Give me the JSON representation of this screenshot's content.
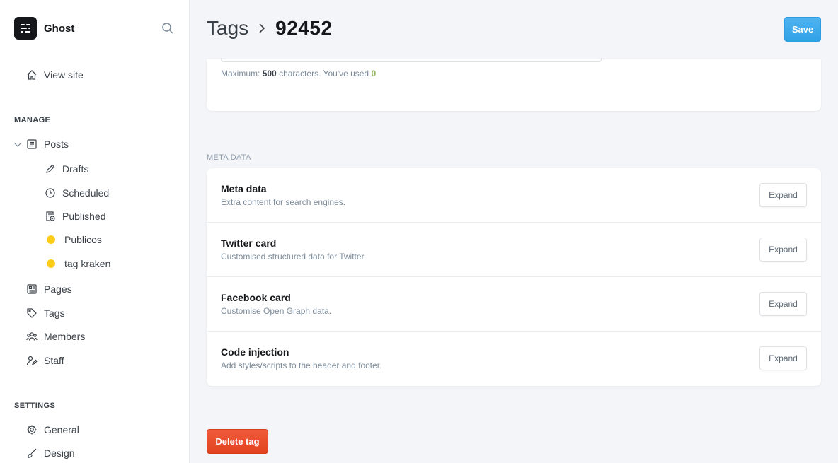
{
  "brand": {
    "name": "Ghost"
  },
  "sidebar": {
    "view_site": "View site",
    "manage_label": "MANAGE",
    "posts": "Posts",
    "drafts": "Drafts",
    "scheduled": "Scheduled",
    "published": "Published",
    "publicos": "Publicos",
    "tag_kraken": "tag kraken",
    "pages": "Pages",
    "tags": "Tags",
    "members": "Members",
    "staff": "Staff",
    "settings_label": "SETTINGS",
    "general": "General",
    "design": "Design"
  },
  "header": {
    "breadcrumb_parent": "Tags",
    "breadcrumb_current": "92452",
    "save_label": "Save"
  },
  "description": {
    "max_prefix": "Maximum:",
    "max_value": "500",
    "max_suffix": "characters. You've used",
    "used_value": "0"
  },
  "meta": {
    "section_label": "META DATA",
    "rows": [
      {
        "title": "Meta data",
        "desc": "Extra content for search engines.",
        "button": "Expand"
      },
      {
        "title": "Twitter card",
        "desc": "Customised structured data for Twitter.",
        "button": "Expand"
      },
      {
        "title": "Facebook card",
        "desc": "Customise Open Graph data.",
        "button": "Expand"
      },
      {
        "title": "Code injection",
        "desc": "Add styles/scripts to the header and footer.",
        "button": "Expand"
      }
    ]
  },
  "delete_label": "Delete tag",
  "colors": {
    "save": "#30a2e6",
    "delete": "#e2431f",
    "tag_dot": "#fecd1b",
    "used_count": "#8fb35a"
  }
}
